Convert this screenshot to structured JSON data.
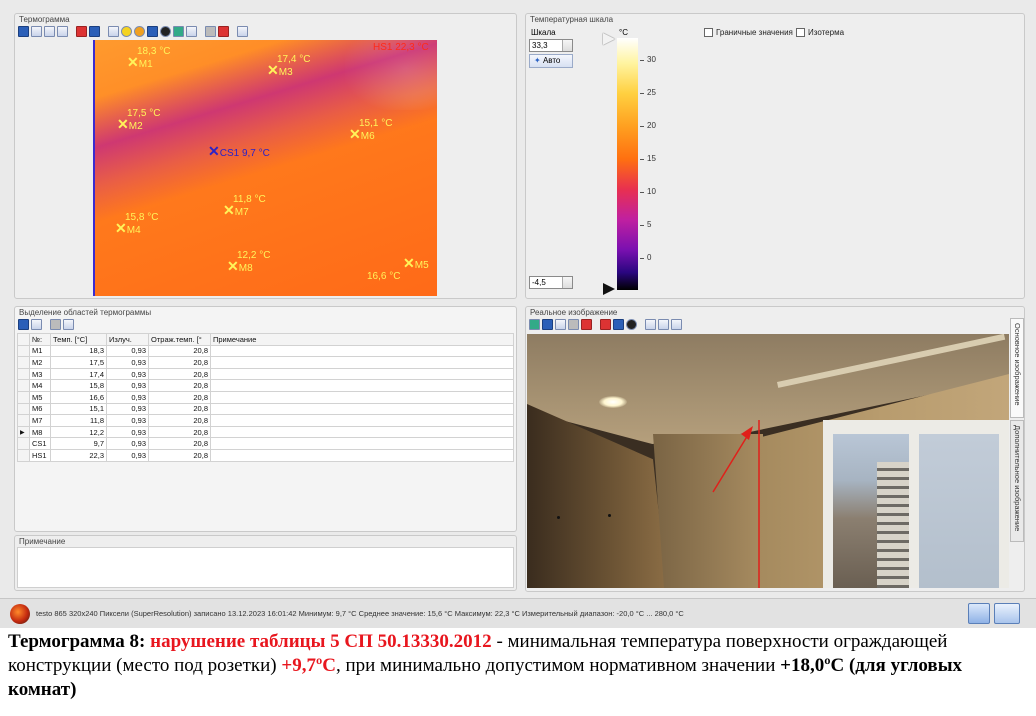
{
  "panels": {
    "thermogram_title": "Термограмма",
    "scale_title": "Температурная шкала",
    "regions_title": "Выделение областей термограммы",
    "note_title": "Примечание",
    "real_image_title": "Реальное изображение"
  },
  "thermogram": {
    "hotspot_label": "HS1 22,3 °C",
    "coldspot_label": "CS1 9,7 °C",
    "markers": [
      {
        "id": "M1",
        "temp": "18,3 °C"
      },
      {
        "id": "M2",
        "temp": "17,5 °C"
      },
      {
        "id": "M3",
        "temp": "17,4 °C"
      },
      {
        "id": "M4",
        "temp": "15,8 °C"
      },
      {
        "id": "M5",
        "temp": "16,6 °C"
      },
      {
        "id": "M6",
        "temp": "15,1 °C"
      },
      {
        "id": "M7",
        "temp": "11,8 °C"
      },
      {
        "id": "M8",
        "temp": "12,2 °C"
      }
    ]
  },
  "scale": {
    "label": "Шкала",
    "max_value": "33,3",
    "min_value": "-4,5",
    "auto_label": "Авто",
    "unit": "°C",
    "ticks": [
      "30",
      "25",
      "20",
      "15",
      "10",
      "5",
      "0"
    ],
    "boundary_values_label": "Граничные значения",
    "isotherm_label": "Изотерма"
  },
  "table": {
    "headers": [
      "№:",
      "Темп. [°C]",
      "Излуч.",
      "Отраж.темп. [°",
      "Примечание"
    ],
    "rows": [
      [
        "M1",
        "18,3",
        "0,93",
        "20,8",
        ""
      ],
      [
        "M2",
        "17,5",
        "0,93",
        "20,8",
        ""
      ],
      [
        "M3",
        "17,4",
        "0,93",
        "20,8",
        ""
      ],
      [
        "M4",
        "15,8",
        "0,93",
        "20,8",
        ""
      ],
      [
        "M5",
        "16,6",
        "0,93",
        "20,8",
        ""
      ],
      [
        "M6",
        "15,1",
        "0,93",
        "20,8",
        ""
      ],
      [
        "M7",
        "11,8",
        "0,93",
        "20,8",
        ""
      ],
      [
        "M8",
        "12,2",
        "0,93",
        "20,8",
        ""
      ],
      [
        "CS1",
        "9,7",
        "0,93",
        "20,8",
        ""
      ],
      [
        "HS1",
        "22,3",
        "0,93",
        "20,8",
        ""
      ]
    ],
    "selected_row": 7
  },
  "side_tabs": [
    "Основное изображение",
    "Дополнительное изображение"
  ],
  "status_bar": "testo 865 320x240 Пиксели (SuperResolution) записано 13.12.2023 16:01:42 Минимум: 9,7 °C Среднее значение: 15,6 °C Максимум: 22,3 °C Измерительный диапазон: -20,0 °C ... 280,0 °C",
  "caption": {
    "label": "Термограмма  8: ",
    "violation": "нарушение таблицы 5 СП 50.13330.2012",
    "text1": " - минимальная температура поверхности ограждающей конструкции (место под розетки) ",
    "min_value": "+9,7ºС",
    "text2": ", при минимально допустимом нормативном значении ",
    "norm_value": "+18,0ºС (для угловых комнат)"
  }
}
